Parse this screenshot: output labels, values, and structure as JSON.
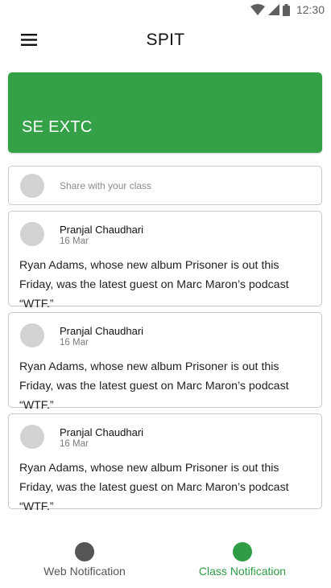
{
  "status_bar": {
    "time": "12:30",
    "icons": [
      "wifi-icon",
      "signal-icon",
      "battery-icon"
    ]
  },
  "app_bar": {
    "title": "SPIT",
    "menu_icon": "hamburger-menu-icon"
  },
  "class_banner": {
    "name": "SE EXTC",
    "color": "#34a149"
  },
  "share": {
    "placeholder": "Share with your class"
  },
  "posts": [
    {
      "author": "Pranjal Chaudhari",
      "date": "16 Mar",
      "body": "Ryan Adams, whose new album Prisoner is out this Friday, was the latest guest on Marc Maron’s podcast “WTF.”"
    },
    {
      "author": "Pranjal Chaudhari",
      "date": "16 Mar",
      "body": "Ryan Adams, whose new album Prisoner is out this Friday, was the latest guest on Marc Maron’s podcast “WTF.”"
    },
    {
      "author": "Pranjal Chaudhari",
      "date": "16 Mar",
      "body": "Ryan Adams, whose new album Prisoner is out this Friday, was the latest guest on Marc Maron’s podcast “WTF.”"
    }
  ],
  "bottom_nav": {
    "web": {
      "label": "Web Notification",
      "color": "#555555"
    },
    "class": {
      "label": "Class Notification",
      "color": "#2e9d45",
      "active": true
    }
  }
}
